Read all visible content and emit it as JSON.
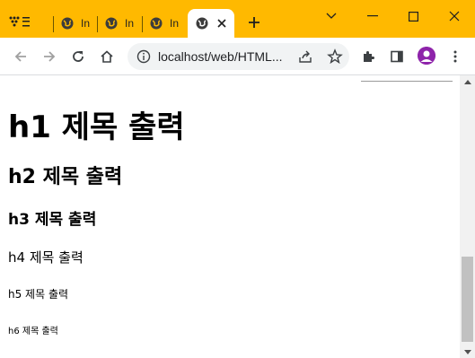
{
  "browser": {
    "tabs": [
      {
        "title": "In",
        "active": false
      },
      {
        "title": "In",
        "active": false
      },
      {
        "title": "In",
        "active": false
      },
      {
        "title": "",
        "active": true
      }
    ],
    "address": {
      "url": "localhost/web/HTML..."
    }
  },
  "page": {
    "headings": {
      "h1": "h1 제목 출력",
      "h2": "h2 제목 출력",
      "h3": "h3 제목 출력",
      "h4": "h4 제목 출력",
      "h5": "h5 제목 출력",
      "h6": "h6 제목 출력"
    }
  },
  "colors": {
    "frame": "#ffb900",
    "avatar": "#8e24aa",
    "scroll_thumb": "#c1c1c1"
  }
}
